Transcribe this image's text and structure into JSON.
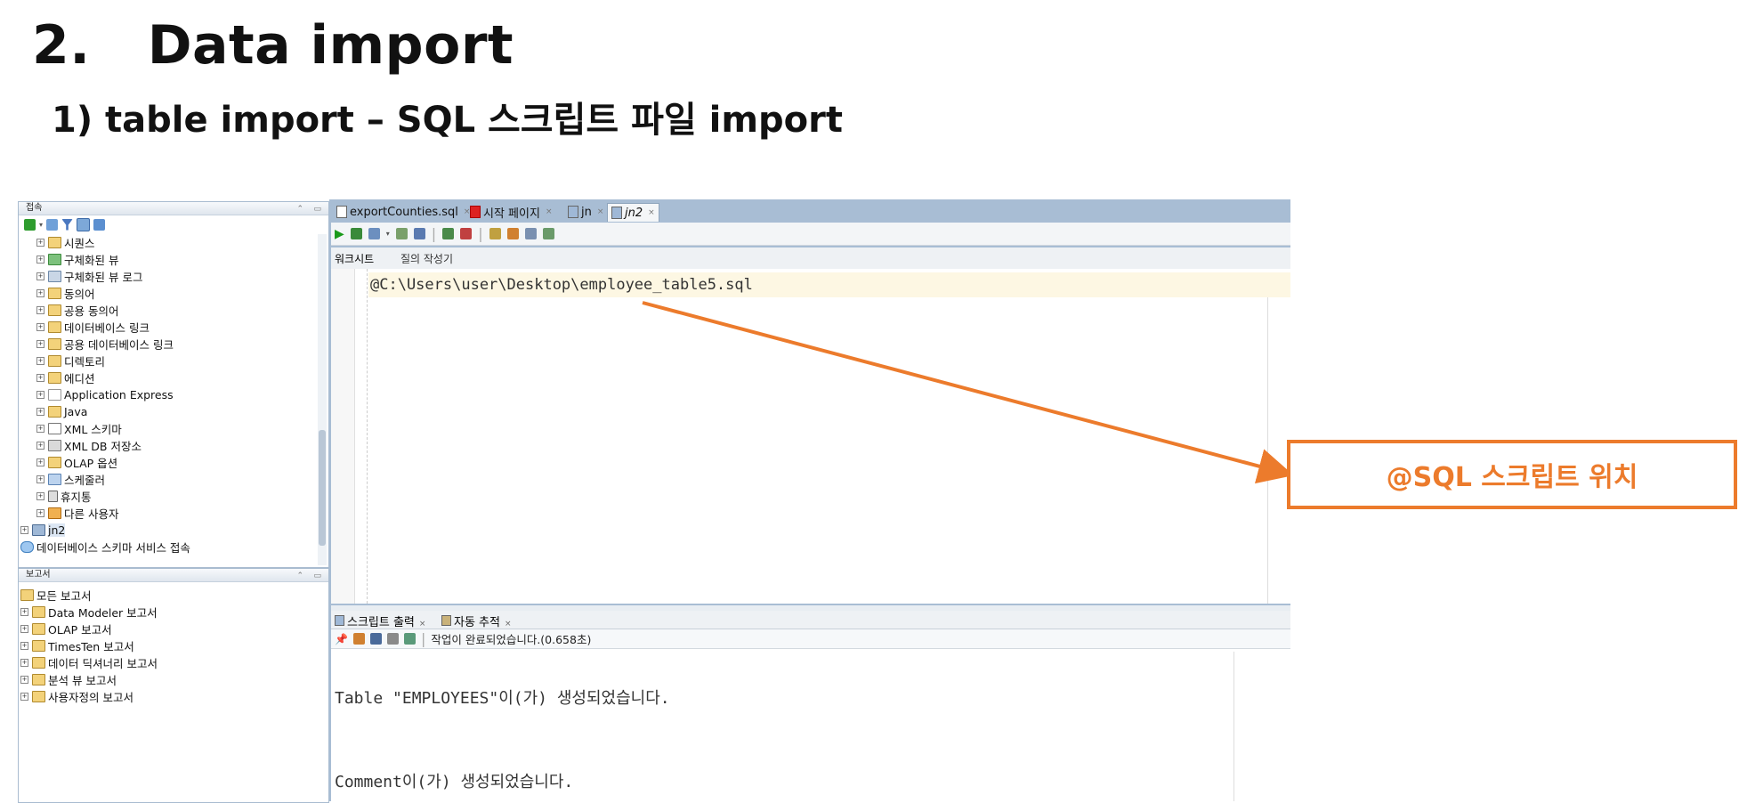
{
  "slide": {
    "title": "2.   Data import",
    "subtitle": "1) table import – SQL 스크립트 파일 import",
    "callout": "@SQL 스크립트 위치"
  },
  "connections_panel": {
    "title": "접속",
    "tree": [
      {
        "label": "시퀀스",
        "level": 1
      },
      {
        "label": "구체화된 뷰",
        "level": 1
      },
      {
        "label": "구체화된 뷰 로그",
        "level": 1
      },
      {
        "label": "동의어",
        "level": 1
      },
      {
        "label": "공용 동의어",
        "level": 1
      },
      {
        "label": "데이터베이스 링크",
        "level": 1
      },
      {
        "label": "공용 데이터베이스 링크",
        "level": 1
      },
      {
        "label": "디렉토리",
        "level": 1
      },
      {
        "label": "에디션",
        "level": 1
      },
      {
        "label": "Application Express",
        "level": 1
      },
      {
        "label": "Java",
        "level": 1
      },
      {
        "label": "XML 스키마",
        "level": 1
      },
      {
        "label": "XML DB 저장소",
        "level": 1
      },
      {
        "label": "OLAP 옵션",
        "level": 1
      },
      {
        "label": "스케줄러",
        "level": 1
      },
      {
        "label": "휴지통",
        "level": 1
      },
      {
        "label": "다른 사용자",
        "level": 1
      },
      {
        "label": "jn2",
        "level": 0
      },
      {
        "label": "데이터베이스 스키마 서비스 접속",
        "level": 0
      }
    ]
  },
  "reports_panel": {
    "title": "보고서",
    "tree": [
      {
        "label": "모든 보고서",
        "level": 0
      },
      {
        "label": "Data Modeler 보고서",
        "level": 1
      },
      {
        "label": "OLAP 보고서",
        "level": 1
      },
      {
        "label": "TimesTen 보고서",
        "level": 1
      },
      {
        "label": "데이터 딕셔너리 보고서",
        "level": 1
      },
      {
        "label": "분석 뷰 보고서",
        "level": 1
      },
      {
        "label": "사용자정의 보고서",
        "level": 1
      }
    ]
  },
  "editor": {
    "tabs": [
      {
        "label": "exportCounties.sql"
      },
      {
        "label": "시작 페이지"
      },
      {
        "label": "jn"
      },
      {
        "label": "jn2",
        "active": true
      }
    ],
    "subtabs": [
      "워크시트",
      "질의 작성기"
    ],
    "code_line": "@C:\\Users\\user\\Desktop\\employee_table5.sql"
  },
  "output": {
    "tabs": [
      "스크립트 출력",
      "자동 추적"
    ],
    "status": "작업이 완료되었습니다.(0.658초)",
    "lines": [
      "Table \"EMPLOYEES\"이(가) 생성되었습니다.",
      "Comment이(가) 생성되었습니다."
    ]
  },
  "colors": {
    "accent": "#ec7b2c",
    "frame": "#a8bdd4"
  }
}
